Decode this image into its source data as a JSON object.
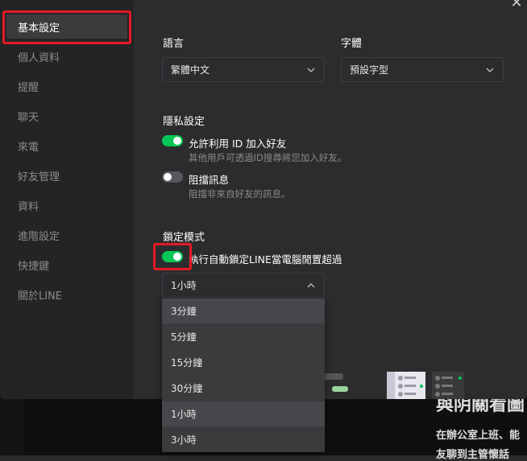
{
  "sidebar": {
    "items": [
      {
        "label": "基本設定",
        "active": true
      },
      {
        "label": "個人資料"
      },
      {
        "label": "提醒"
      },
      {
        "label": "聊天"
      },
      {
        "label": "來電"
      },
      {
        "label": "好友管理"
      },
      {
        "label": "資料"
      },
      {
        "label": "進階設定"
      },
      {
        "label": "快捷鍵"
      },
      {
        "label": "關於LINE"
      }
    ]
  },
  "language": {
    "label": "語言",
    "value": "繁體中文"
  },
  "font": {
    "label": "字體",
    "value": "預設字型"
  },
  "privacy": {
    "title": "隱私設定",
    "allow_id": {
      "label": "允許利用 ID 加入好友",
      "desc": "其他用戶可透過ID搜尋將您加入好友。",
      "on": true
    },
    "block_messages": {
      "label": "阻擋訊息",
      "desc": "阻擋非來自好友的訊息。",
      "on": false
    }
  },
  "lock": {
    "title": "鎖定模式",
    "auto_lock_label": "執行自動鎖定LINE當電腦閒置超過",
    "on": true,
    "selected": "1小時",
    "options": [
      "3分鐘",
      "5分鐘",
      "15分鐘",
      "30分鐘",
      "1小時",
      "3小時"
    ],
    "hovered_option": "3分鐘"
  },
  "background": {
    "heading": "與阴關看圖",
    "line1": "在辦公室上班、能",
    "line2": "友聊到主管懷話"
  },
  "colors": {
    "accent": "#06c755",
    "highlight": "#e31b23"
  },
  "icons": {
    "close": "close-icon",
    "chevron": "chevron-down-icon"
  }
}
